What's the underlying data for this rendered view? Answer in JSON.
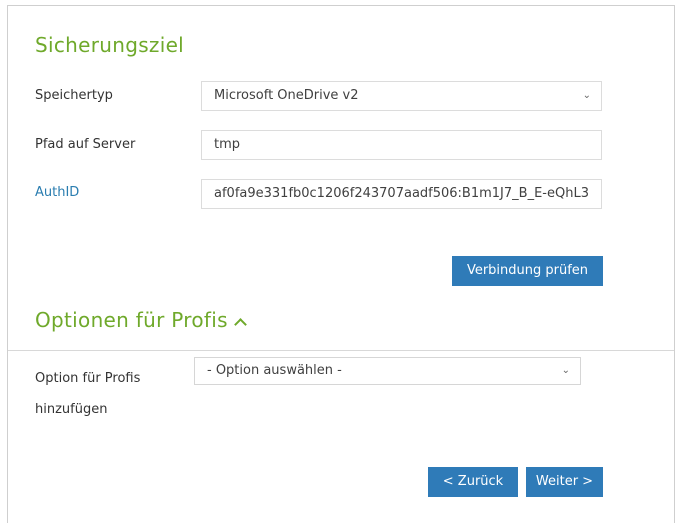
{
  "backup_target": {
    "title": "Sicherungsziel",
    "storage_type": {
      "label": "Speichertyp",
      "value": "Microsoft OneDrive v2"
    },
    "server_path": {
      "label": "Pfad auf Server",
      "value": "tmp"
    },
    "auth_id": {
      "label": "AuthID",
      "value": "af0fa9e331fb0c1206f243707aadf506:B1m1J7_B_E-eQhL3"
    },
    "check_connection_label": "Verbindung prüfen"
  },
  "pro_options": {
    "title": "Optionen für Profis",
    "add_option": {
      "label_line1": "Option für Profis",
      "label_line2": "hinzufügen",
      "placeholder": "- Option auswählen -"
    }
  },
  "nav": {
    "back_label": "< Zurück",
    "next_label": "Weiter >"
  },
  "colors": {
    "accent_green": "#6fa92b",
    "button_blue": "#2f7bb8",
    "link_blue": "#2a7db0"
  },
  "icons": {
    "select_chevron": "chevron-down-icon",
    "section_toggle": "chevron-up-icon"
  }
}
